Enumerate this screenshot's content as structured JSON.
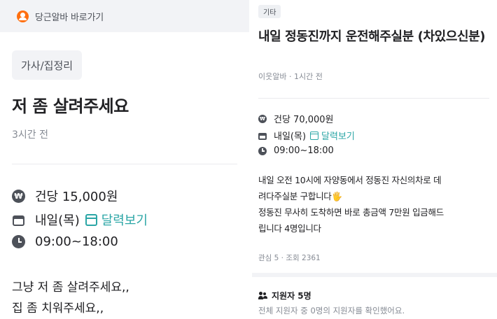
{
  "left": {
    "topbar": {
      "label": "당근알바 바로가기",
      "icon": "daangn-logo-icon"
    },
    "category": "가사/집정리",
    "title": "저 좀 살려주세요",
    "time_ago": "3시간 전",
    "info": {
      "pay": "건당 15,000원",
      "date": "내일(목)",
      "calendar_link": "달력보기",
      "hours": "09:00~18:00"
    },
    "body_lines": [
      "그냥 저 좀 살려주세요,,",
      "집 좀 치워주세요,,"
    ]
  },
  "right": {
    "category": "기타",
    "title": "내일 정동진까지 운전해주실분 (차있으신분)",
    "meta": "이웃알바 · 1시간 전",
    "info": {
      "pay": "건당 70,000원",
      "date": "내일(목)",
      "calendar_link": "달력보기",
      "hours": "09:00~18:00"
    },
    "body_lines": [
      "내일 오전 10시에  자양동에서 정동진 자신의차로 데",
      "려다주실분 구합니다🖐",
      "정동진 무사히 도착하면 바로 총금액 7만원 입금해드",
      "립니다 4명입니다"
    ],
    "stats": "관심 5 · 조회 2361",
    "applicants": {
      "label": "지원자 5명",
      "note": "전체 지원자 중 0명의 지원자를 확인했어요."
    }
  },
  "colors": {
    "accent": "#ff6f0f",
    "link": "#2ba6a6",
    "muted": "#868b94",
    "text": "#212124"
  }
}
